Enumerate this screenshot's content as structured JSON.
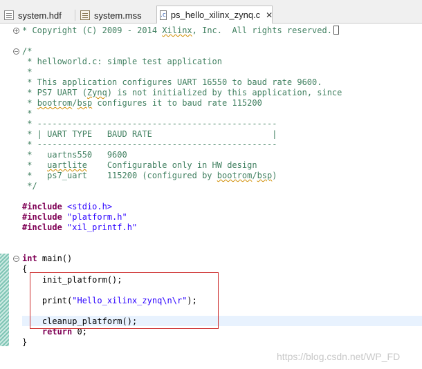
{
  "tabs": [
    {
      "label": "system.hdf",
      "icon": "hdf-file-icon"
    },
    {
      "label": "system.mss",
      "icon": "mss-file-icon"
    },
    {
      "label": "ps_hello_xilinx_zynq.c",
      "icon": "c-file-icon",
      "active": true,
      "close": "✕"
    }
  ],
  "code": {
    "lines": [
      "* Copyright (C) 2009 - 2014 Xilinx, Inc.  All rights reserved.",
      "/*",
      " * helloworld.c: simple test application",
      " *",
      " * This application configures UART 16550 to baud rate 9600.",
      " * PS7 UART (Zynq) is not initialized by this application, since",
      " * bootrom/bsp configures it to baud rate 115200",
      " *",
      " * ------------------------------------------------",
      " * | UART TYPE   BAUD RATE                        |",
      " * ------------------------------------------------",
      " *   uartns550   9600",
      " *   uartlite    Configurable only in HW design",
      " *   ps7_uart    115200 (configured by bootrom/bsp)",
      " */",
      "#include <stdio.h>",
      "#include \"platform.h\"",
      "#include \"xil_printf.h\"",
      "int main()",
      "{",
      "    init_platform();",
      "    print(\"Hello_xilinx_zynq\\n\\r\");",
      "    cleanup_platform();",
      "    return 0;",
      "}"
    ]
  },
  "watermark": "https://blog.csdn.net/WP_FD",
  "colors": {
    "comment": "#3f7f5f",
    "keyword": "#7f0055",
    "string": "#2a00ff",
    "highlight_box": "#cc2a2a"
  }
}
